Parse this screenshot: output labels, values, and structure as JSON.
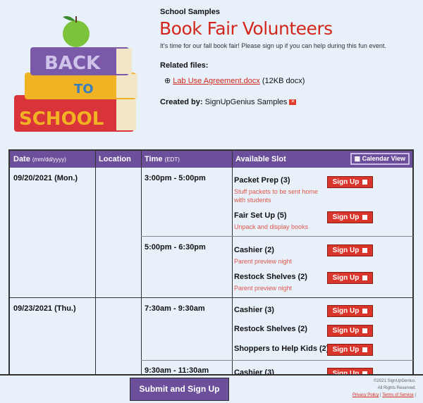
{
  "header": {
    "organization": "School Samples",
    "title": "Book Fair Volunteers",
    "description": "It's time for our fall book fair!  Please sign up if you can help during this fun event.",
    "related_files_label": "Related files:",
    "file": {
      "name": "Lab Use Agreement.docx",
      "meta": "(12KB docx)"
    },
    "created_by_label": "Created by:",
    "created_by": "SignUpGenius Samples"
  },
  "logo": {
    "lines": [
      "BACK",
      "TO",
      "SCHOOL"
    ]
  },
  "table": {
    "columns": {
      "date": "Date",
      "date_hint": "(mm/dd/yyyy)",
      "location": "Location",
      "time": "Time",
      "time_hint": "(EDT)",
      "slot": "Available Slot"
    },
    "calendar_view": "Calendar View",
    "sign_up": "Sign Up",
    "rows": [
      {
        "date": "09/20/2021 (Mon.)",
        "times": [
          {
            "time": "3:00pm - 5:00pm",
            "slots": [
              {
                "name": "Packet Prep (3)",
                "desc": "Stuff packets to be sent home with students"
              },
              {
                "name": "Fair Set Up (5)",
                "desc": "Unpack and display books"
              }
            ]
          },
          {
            "time": "5:00pm - 6:30pm",
            "slots": [
              {
                "name": "Cashier (2)",
                "desc": "Parent preview night"
              },
              {
                "name": "Restock Shelves (2)",
                "desc": "Parent preview night"
              }
            ]
          }
        ]
      },
      {
        "date": "09/23/2021 (Thu.)",
        "times": [
          {
            "time": "7:30am - 9:30am",
            "slots": [
              {
                "name": "Cashier (3)"
              },
              {
                "name": "Restock Shelves (2)"
              },
              {
                "name": "Shoppers to Help Kids (2)"
              }
            ]
          },
          {
            "time": "9:30am - 11:30am",
            "slots": [
              {
                "name": "Cashier (3)"
              }
            ]
          }
        ]
      }
    ]
  },
  "footer": {
    "submit": "Submit and Sign Up",
    "copyright": "©2021 SignUpGenius.",
    "rights": "All Rights Reserved.",
    "privacy": "Privacy Policy",
    "terms": "Terms of Service"
  },
  "colors": {
    "accent": "#6b4f9b",
    "title": "#d3271c",
    "button": "#d9352a"
  }
}
